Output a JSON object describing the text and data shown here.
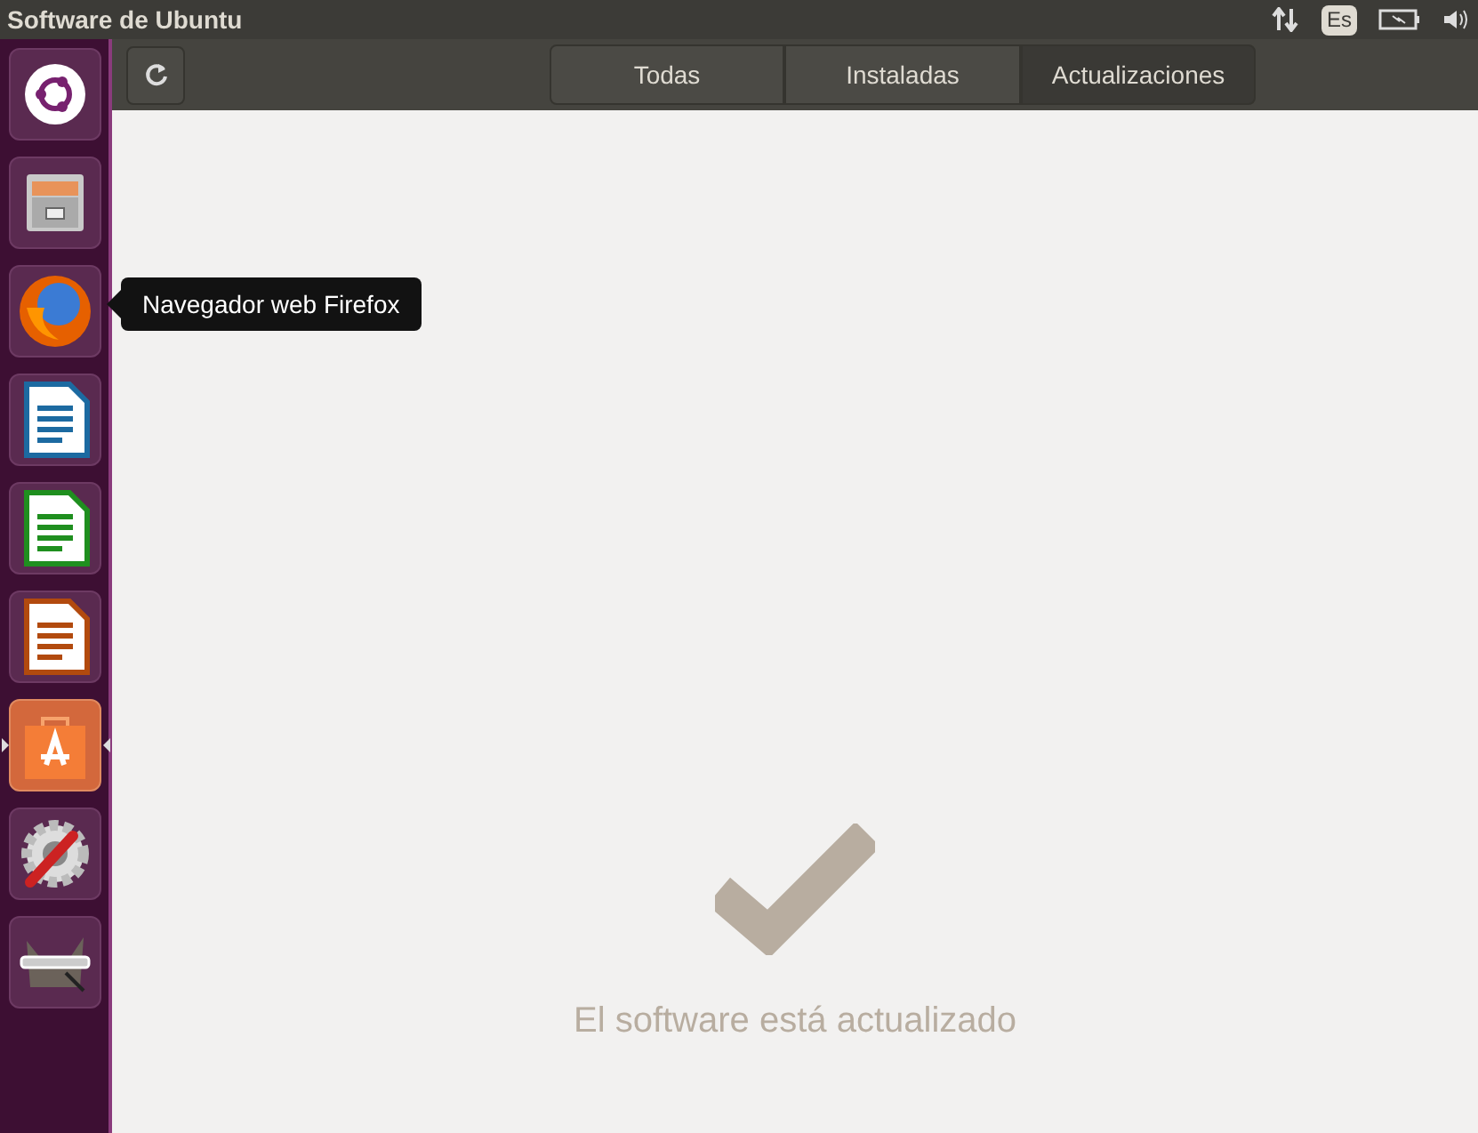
{
  "top_bar": {
    "title": "Software de Ubuntu",
    "keyboard_layout": "Es"
  },
  "launcher": {
    "items": [
      {
        "kind": "dash",
        "active": false
      },
      {
        "kind": "files",
        "active": false
      },
      {
        "kind": "firefox",
        "active": false
      },
      {
        "kind": "writer",
        "active": false
      },
      {
        "kind": "calc",
        "active": false
      },
      {
        "kind": "impress",
        "active": false
      },
      {
        "kind": "software",
        "active": true
      },
      {
        "kind": "settings",
        "active": false
      },
      {
        "kind": "gimp",
        "active": false
      }
    ]
  },
  "tooltip": {
    "text": "Navegador web Firefox"
  },
  "toolbar": {
    "tabs": [
      {
        "label": "Todas",
        "selected": false
      },
      {
        "label": "Instaladas",
        "selected": false
      },
      {
        "label": "Actualizaciones",
        "selected": true
      }
    ]
  },
  "status": {
    "message": "El software está actualizado"
  }
}
